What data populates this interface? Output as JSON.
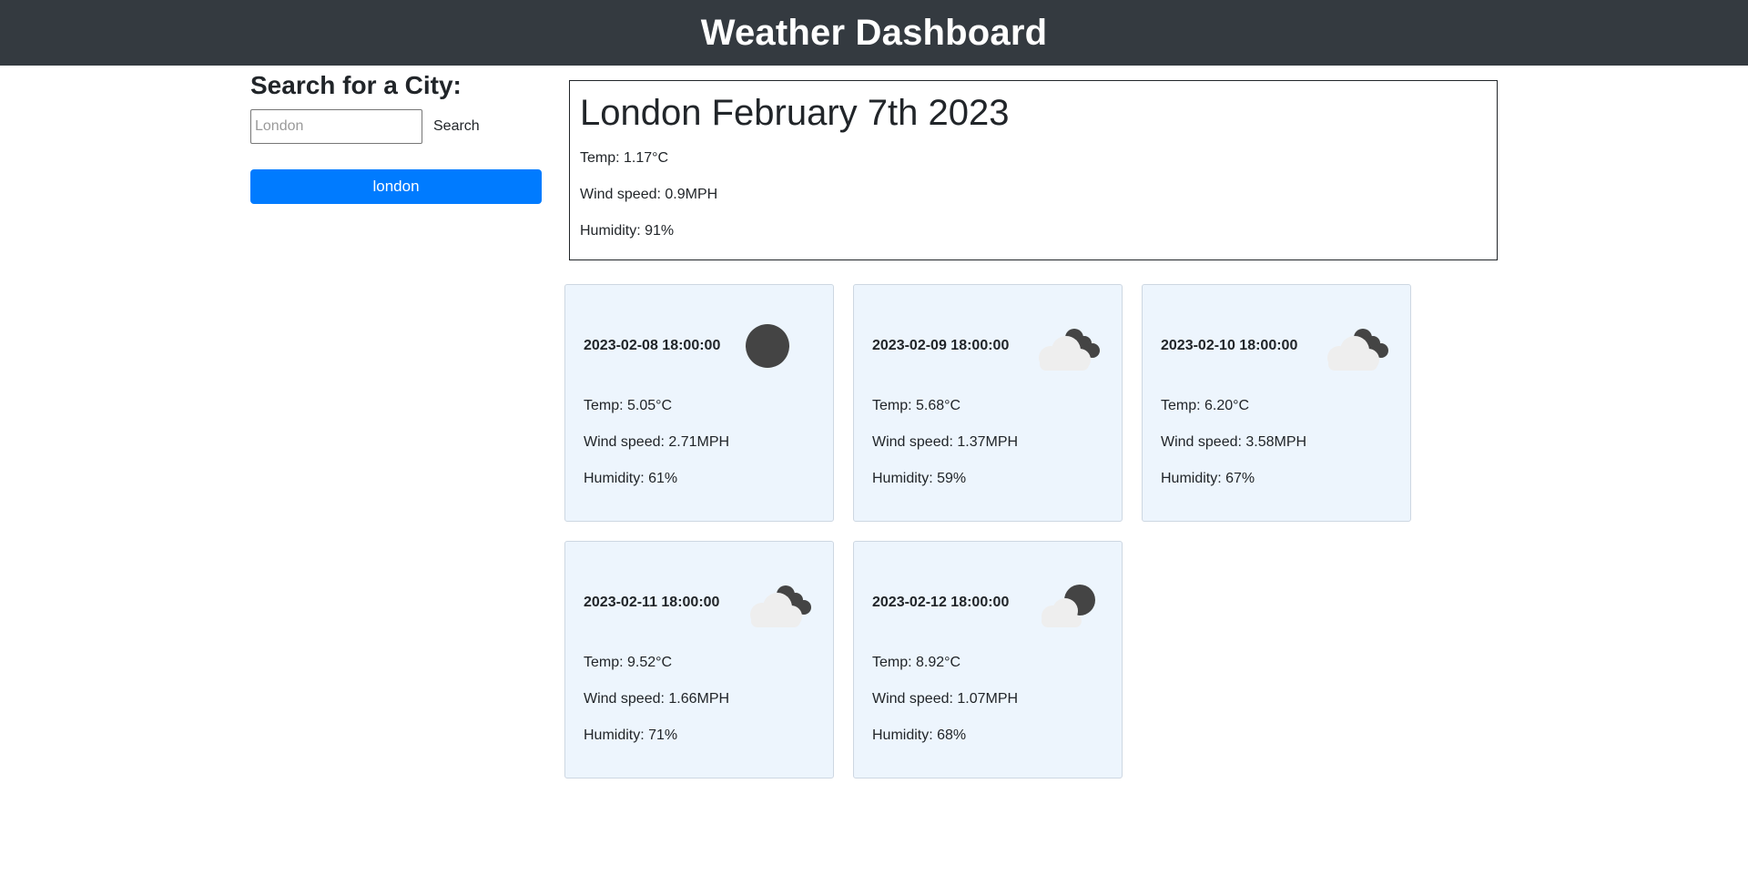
{
  "header": {
    "title": "Weather Dashboard"
  },
  "search": {
    "heading": "Search for a City:",
    "placeholder": "London",
    "button_label": "Search"
  },
  "history": [
    {
      "label": "london"
    }
  ],
  "current": {
    "title": "London February 7th 2023",
    "temp": "Temp: 1.17°C",
    "wind": "Wind speed: 0.9MPH",
    "humidity": "Humidity: 91%"
  },
  "forecast": [
    {
      "date": "2023-02-08 18:00:00",
      "icon": "night-clear-icon",
      "temp": "Temp: 5.05°C",
      "wind": "Wind speed: 2.71MPH",
      "humidity": "Humidity: 61%"
    },
    {
      "date": "2023-02-09 18:00:00",
      "icon": "broken-clouds-icon",
      "temp": "Temp: 5.68°C",
      "wind": "Wind speed: 1.37MPH",
      "humidity": "Humidity: 59%"
    },
    {
      "date": "2023-02-10 18:00:00",
      "icon": "broken-clouds-icon",
      "temp": "Temp: 6.20°C",
      "wind": "Wind speed: 3.58MPH",
      "humidity": "Humidity: 67%"
    },
    {
      "date": "2023-02-11 18:00:00",
      "icon": "broken-clouds-icon",
      "temp": "Temp: 9.52°C",
      "wind": "Wind speed: 1.66MPH",
      "humidity": "Humidity: 71%"
    },
    {
      "date": "2023-02-12 18:00:00",
      "icon": "night-few-clouds-icon",
      "temp": "Temp: 8.92°C",
      "wind": "Wind speed: 1.07MPH",
      "humidity": "Humidity: 68%"
    }
  ],
  "colors": {
    "navbar": "#343a40",
    "accent": "#007bff",
    "card_bg": "#edf5fd"
  }
}
